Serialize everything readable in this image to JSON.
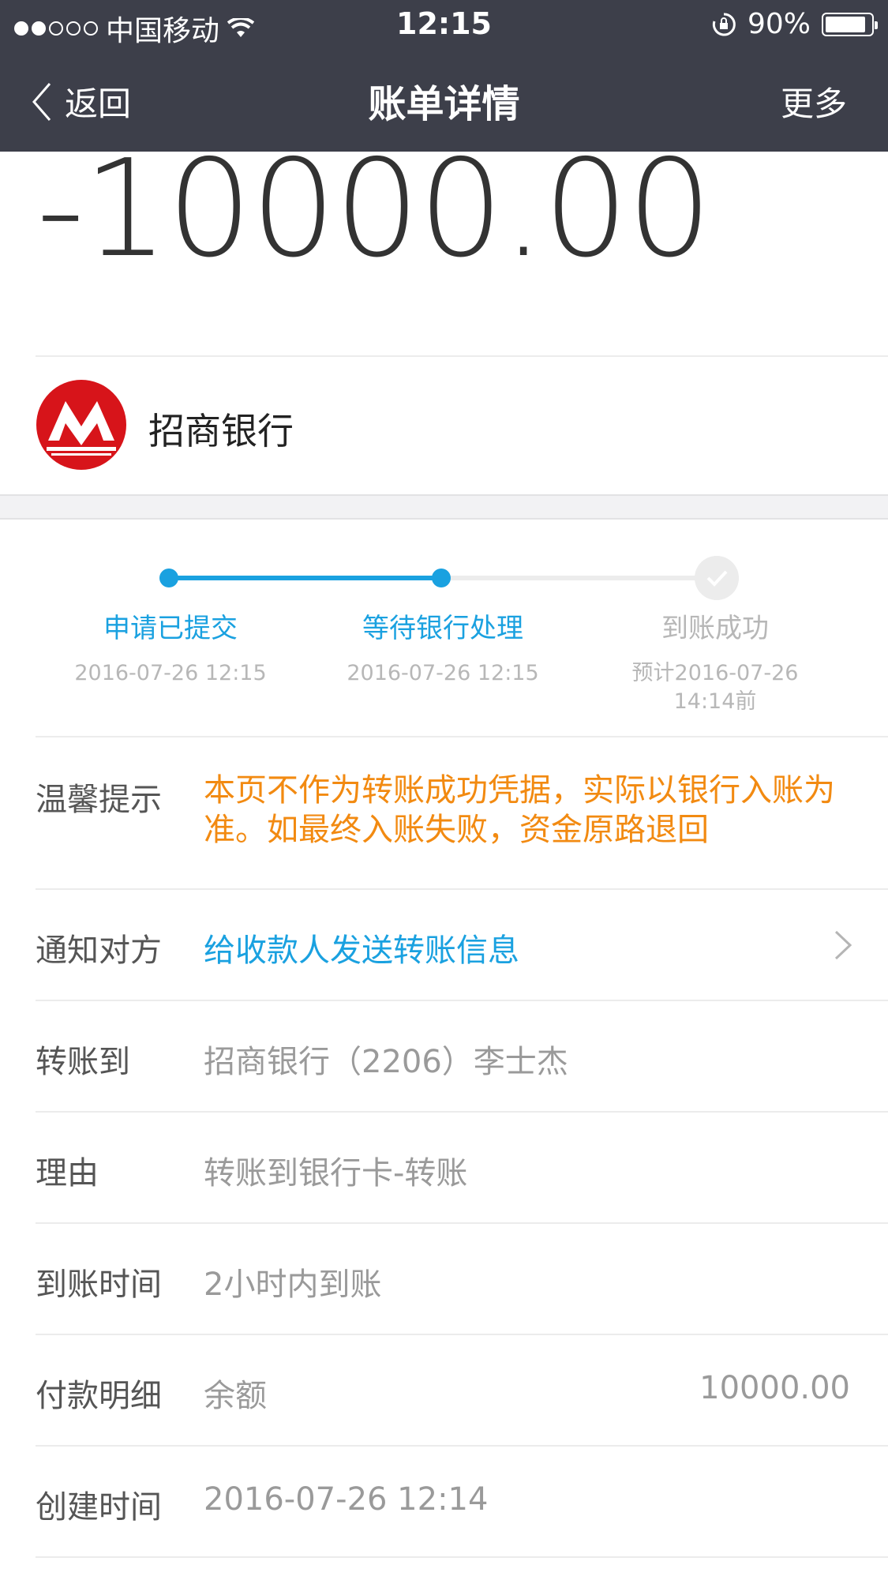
{
  "status_bar": {
    "carrier": "中国移动",
    "time": "12:15",
    "battery": "90%",
    "battery_level": 0.9
  },
  "nav": {
    "back_label": "返回",
    "title": "账单详情",
    "more_label": "更多"
  },
  "amount": "-10000.00",
  "bank": {
    "name": "招商银行"
  },
  "progress": {
    "steps": [
      {
        "label": "申请已提交",
        "time": "2016-07-26 12:15",
        "state": "done"
      },
      {
        "label": "等待银行处理",
        "time": "2016-07-26 12:15",
        "state": "current"
      },
      {
        "label": "到账成功",
        "time": "预计2016-07-26 14:14前",
        "state": "pending"
      }
    ]
  },
  "rows": {
    "tip": {
      "key": "温馨提示",
      "value": "本页不作为转账成功凭据，实际以银行入账为准。如最终入账失败，资金原路退回"
    },
    "notify": {
      "key": "通知对方",
      "value": "给收款人发送转账信息"
    },
    "transfer_to": {
      "key": "转账到",
      "value": "招商银行（2206）李士杰"
    },
    "reason": {
      "key": "理由",
      "value": "转账到银行卡-转账"
    },
    "arrival": {
      "key": "到账时间",
      "value": "2小时内到账"
    },
    "payment": {
      "key": "付款明细",
      "value": "余额",
      "amount": "10000.00"
    },
    "created": {
      "key": "创建时间",
      "value": "2016-07-26 12:14"
    }
  },
  "colors": {
    "nav_bg": "#3d3f4a",
    "accent_blue": "#1aa1e0",
    "warning_orange": "#f28a11",
    "bank_red": "#d7141a"
  }
}
